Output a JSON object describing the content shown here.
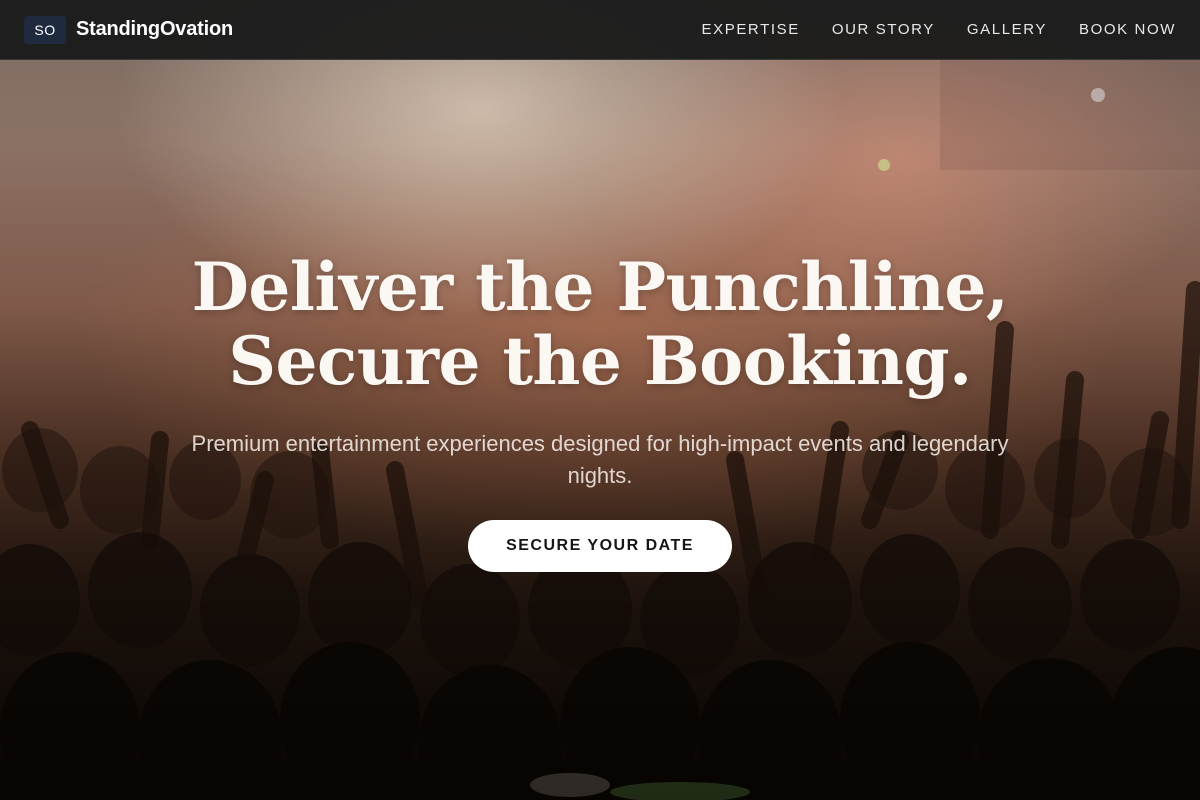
{
  "brand": {
    "badge": "SO",
    "name": "StandingOvation"
  },
  "nav": {
    "items": [
      {
        "label": "EXPERTISE"
      },
      {
        "label": "OUR STORY"
      },
      {
        "label": "GALLERY"
      },
      {
        "label": "BOOK NOW"
      }
    ]
  },
  "hero": {
    "headline_line1": "Deliver the Punchline,",
    "headline_line2": "Secure the Booking.",
    "subtitle": "Premium entertainment experiences designed for high-impact events and legendary nights.",
    "cta_label": "SECURE YOUR DATE",
    "background_description_icon": "concert-crowd-image"
  },
  "colors": {
    "header_bg": "#1c1c1c",
    "badge_bg": "#1f2a3e",
    "cta_bg": "#ffffff",
    "cta_text": "#161616"
  }
}
